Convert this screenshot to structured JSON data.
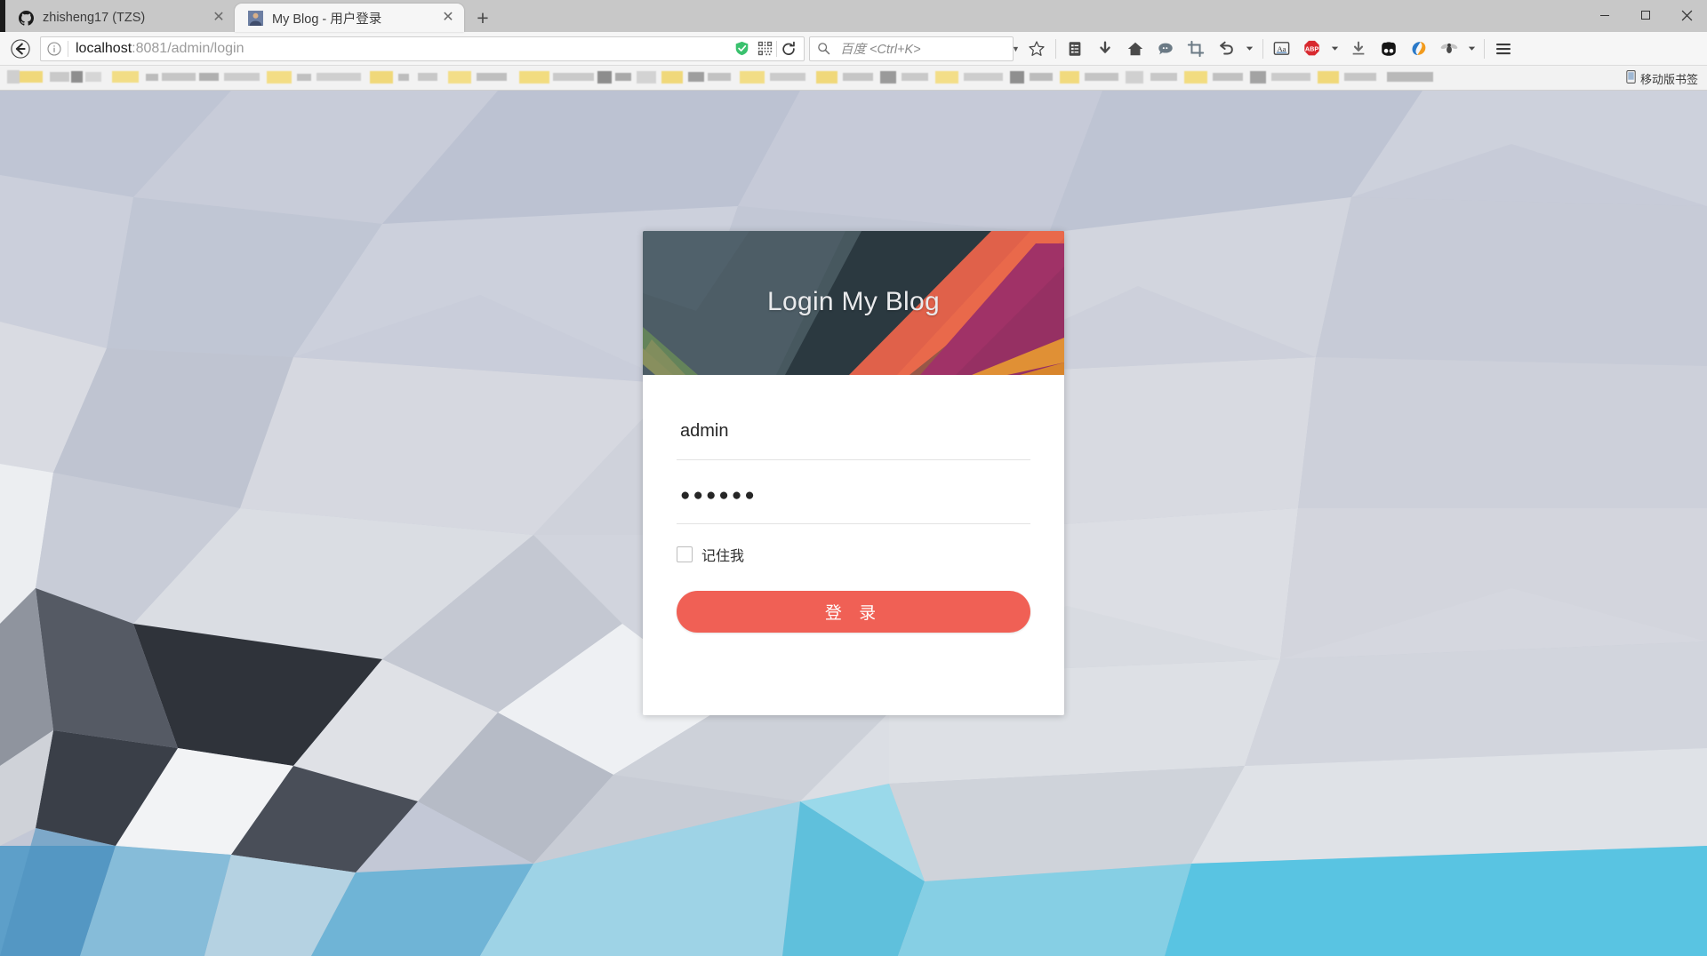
{
  "window": {
    "minimize_label": "─",
    "maximize_label": "❐",
    "close_label": "✕"
  },
  "tabs": [
    {
      "title": "zhisheng17 (TZS)",
      "favicon": "github-icon",
      "close_label": "✕",
      "active": false
    },
    {
      "title": "My Blog - 用户登录",
      "favicon": "avatar-icon",
      "close_label": "✕",
      "active": true
    }
  ],
  "newtab_label": "+",
  "toolbar": {
    "back_icon": "back-arrow-icon",
    "url_prefix": "localhost",
    "url_rest": ":8081/admin/login",
    "info_icon": "page-info-icon",
    "shield_icon": "shield-check-icon",
    "qr_icon": "qr-code-icon",
    "reload_icon": "reload-icon",
    "search_placeholder": "百度 <Ctrl+K>",
    "search_icon": "magnifier-icon",
    "icons": [
      "star-icon",
      "reading-list-icon",
      "download-arrow-icon",
      "home-icon",
      "comment-bubble-icon",
      "screenshot-crop-icon",
      "undo-arrow-icon",
      "chevron-down-icon",
      "translate-aa-icon",
      "adblock-abp-icon",
      "chevron-down-icon-2",
      "download-tray-icon",
      "panda-icon",
      "sogou-icon",
      "fly-icon",
      "chevron-down-icon-3",
      "menu-hamburger-icon"
    ]
  },
  "bookmarks": {
    "mobile_label": "移动版书签",
    "mobile_icon": "mobile-bookmark-icon"
  },
  "login": {
    "card_title": "Login My Blog",
    "username_value": "admin",
    "username_placeholder": "",
    "password_value": "●●●●●●",
    "password_placeholder": "",
    "remember_label": "记住我",
    "remember_checked": false,
    "submit_label": "登 录",
    "accent_color": "#f06055"
  }
}
